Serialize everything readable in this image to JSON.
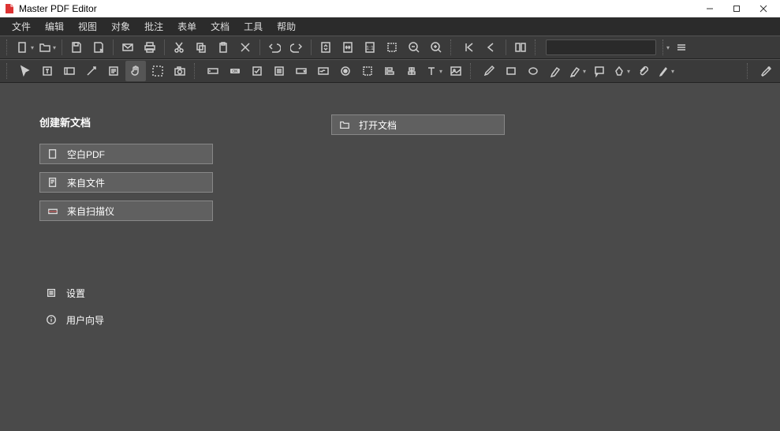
{
  "window": {
    "title": "Master PDF Editor"
  },
  "menu": {
    "items": [
      "文件",
      "编辑",
      "视图",
      "对象",
      "批注",
      "表单",
      "文档",
      "工具",
      "帮助"
    ]
  },
  "start": {
    "create_heading": "创建新文档",
    "blank_pdf": "空白PDF",
    "from_file": "来自文件",
    "from_scanner": "来自扫描仪",
    "open_doc": "打开文档",
    "settings": "设置",
    "user_guide": "用户向导"
  },
  "search": {
    "placeholder": ""
  }
}
